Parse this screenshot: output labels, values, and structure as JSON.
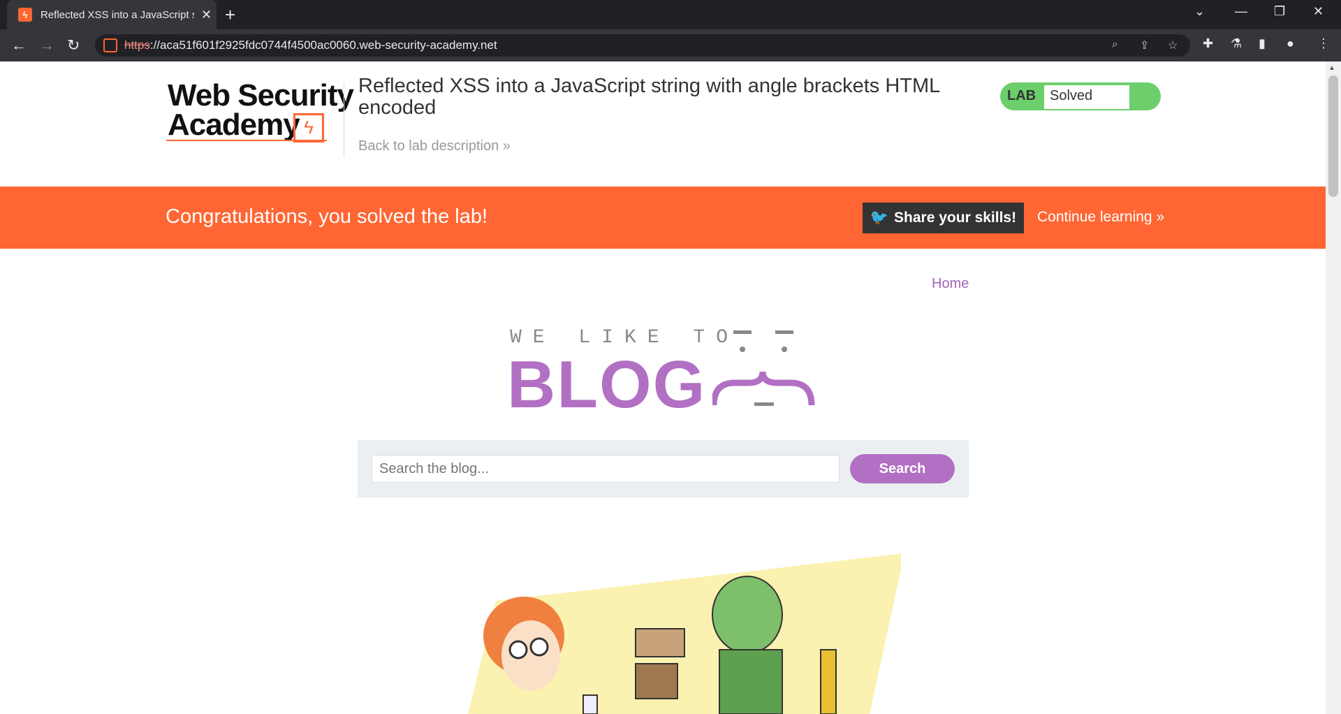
{
  "browser": {
    "tab_title": "Reflected XSS into a JavaScript st",
    "url_scheme": "https",
    "url_rest": "://aca51f601f2925fdc0744f4500ac0060.web-security-academy.net"
  },
  "lab": {
    "logo_line1": "Web Security",
    "logo_line2": "Academy",
    "title": "Reflected XSS into a JavaScript string with angle brackets HTML encoded",
    "back_link": "Back to lab description",
    "status_tag": "LAB",
    "status_value": "Solved"
  },
  "banner": {
    "message": "Congratulations, you solved the lab!",
    "share_label": "Share your skills!",
    "continue_label": "Continue learning"
  },
  "blog": {
    "home_link": "Home",
    "logo_top": "WE LIKE TO",
    "logo_word": "BLOG",
    "search_placeholder": "Search the blog...",
    "search_button": "Search"
  },
  "colors": {
    "accent_orange": "#ff6633",
    "blog_purple": "#b170c3",
    "solved_green": "#6ccf6c"
  }
}
